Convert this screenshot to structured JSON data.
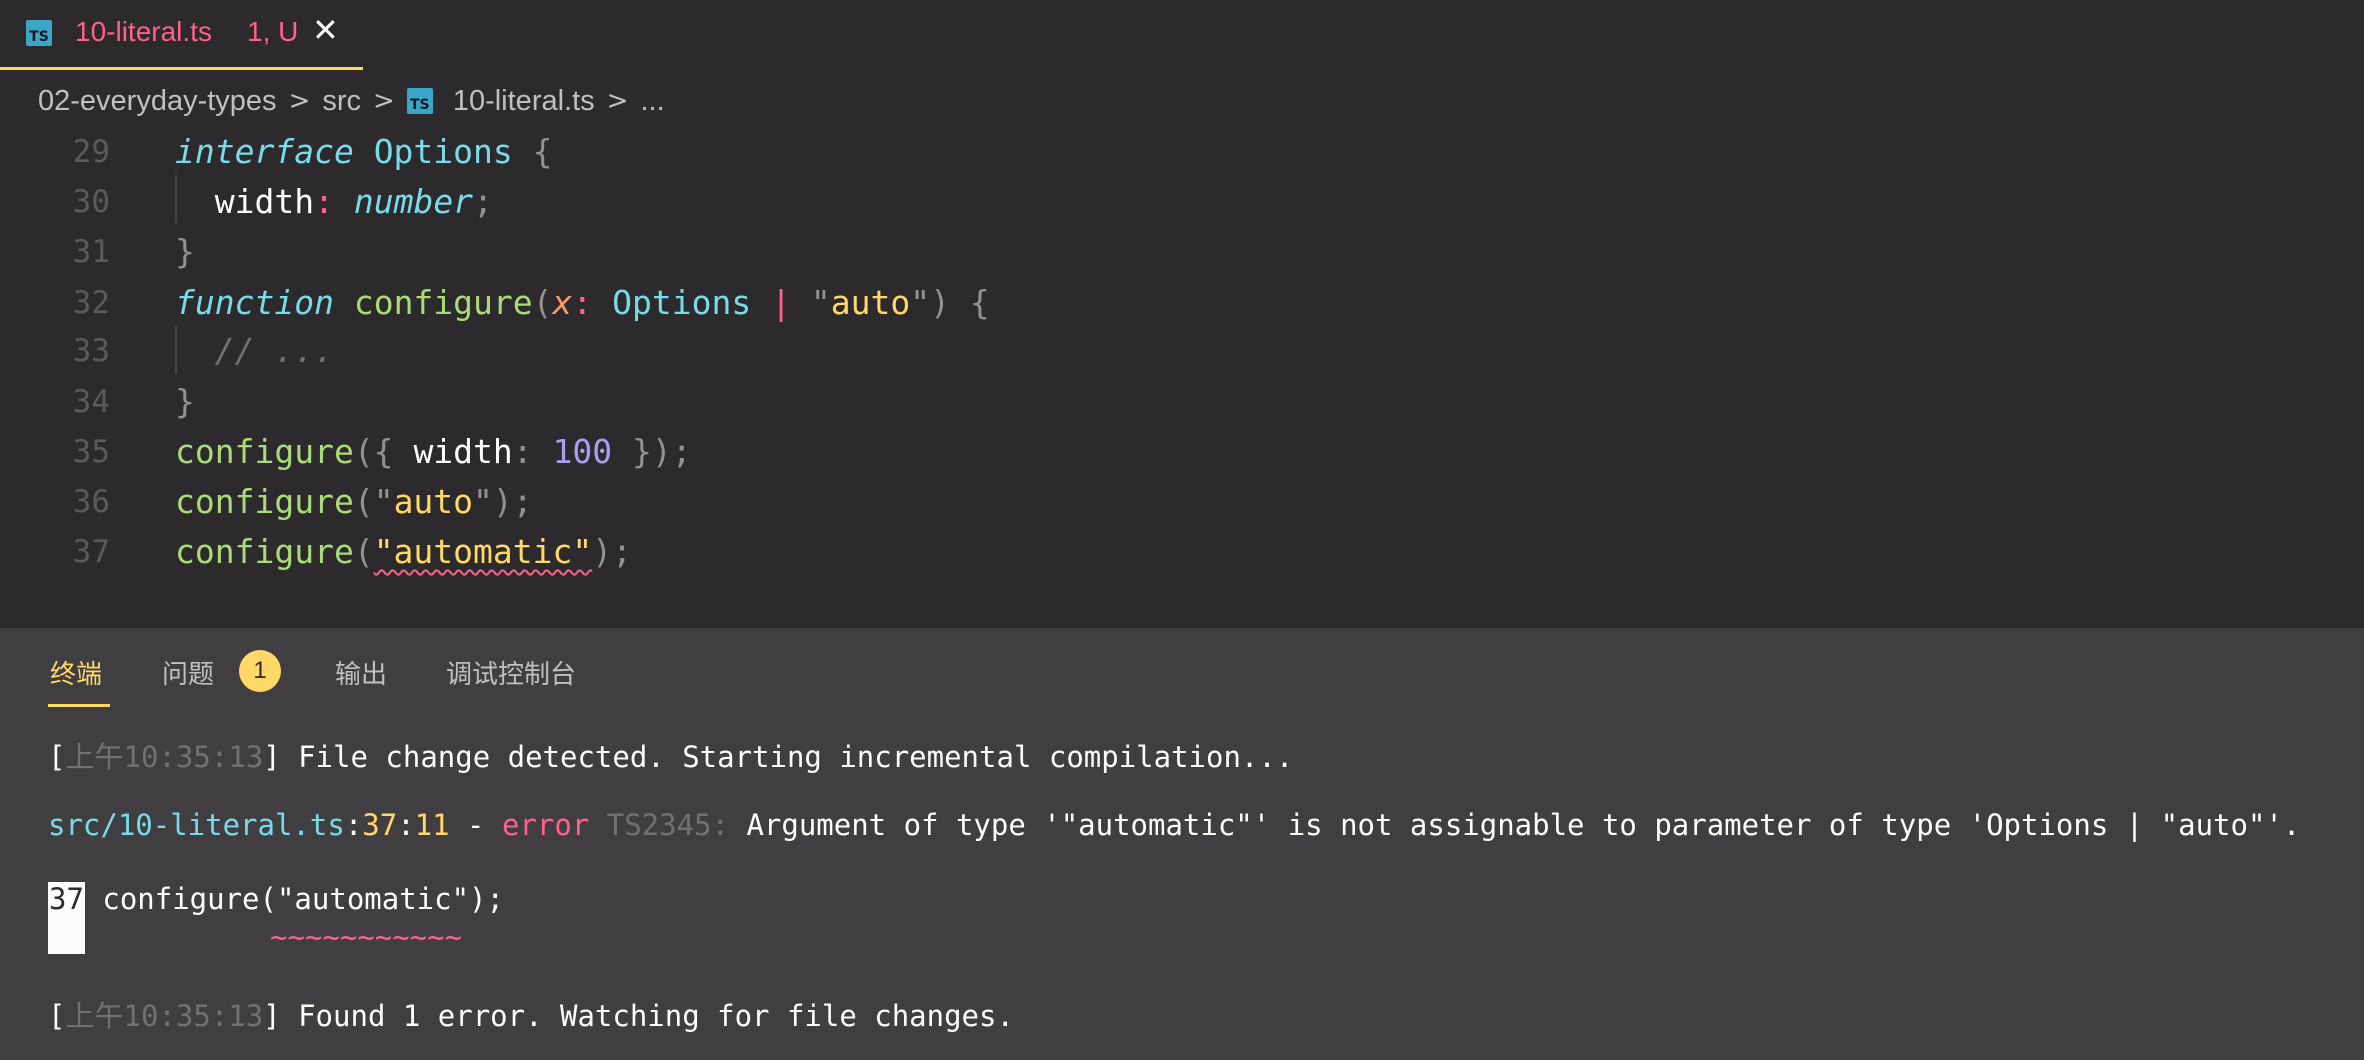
{
  "tab": {
    "icon": "typescript-file-icon",
    "icon_text": "TS",
    "filename": "10-literal.ts",
    "status": "1, U",
    "close_glyph": "✕"
  },
  "breadcrumb": {
    "folder": "02-everyday-types",
    "subfolder": "src",
    "file": "10-literal.ts",
    "more": "...",
    "separator": ">"
  },
  "editor": {
    "line_numbers": [
      "29",
      "30",
      "31",
      "32",
      "33",
      "34",
      "35",
      "36",
      "37"
    ],
    "lines": {
      "l29": {
        "kw": "interface",
        "name": "Options",
        "brace": "{"
      },
      "l30": {
        "prop": "width",
        "colon": ":",
        "type": "number",
        "semi": ";"
      },
      "l31": {
        "brace": "}"
      },
      "l32": {
        "kw": "function",
        "fn": "configure",
        "open": "(",
        "param": "x",
        "colon": ":",
        "type": "Options",
        "pipe": "|",
        "q1": "\"",
        "str": "auto",
        "q2": "\"",
        "close": ")",
        "brace": "{"
      },
      "l33": {
        "comment": "// ..."
      },
      "l34": {
        "brace": "}"
      },
      "l35": {
        "fn": "configure",
        "open": "({",
        "prop": "width",
        "colon": ":",
        "num": "100",
        "close": "});"
      },
      "l36": {
        "fn": "configure",
        "open": "(",
        "q1": "\"",
        "str": "auto",
        "q2": "\"",
        "close": ");"
      },
      "l37": {
        "fn": "configure",
        "open": "(",
        "squig": "\"automatic\"",
        "close": ");"
      }
    }
  },
  "panel": {
    "tabs": {
      "terminal": "终端",
      "problems": "问题",
      "problems_count": "1",
      "output": "输出",
      "debug_console": "调试控制台"
    },
    "terminal": {
      "line1": {
        "open": "[",
        "ampm": "上午",
        "time": "10:35:13",
        "close": "]",
        "text": " File change detected. Starting incremental compilation..."
      },
      "line2": {
        "path": "src/10-literal.ts",
        "c1": ":",
        "line": "37",
        "c2": ":",
        "col": "11",
        "dash": " - ",
        "err": "error",
        "code": " TS2345:",
        "msg": " Argument of type '\"automatic\"' is not assignable to parameter of type 'Options | \"auto\"'."
      },
      "line3": {
        "num": "37",
        "code": " configure(\"automatic\");"
      },
      "tildes": "~~~~~~~~~~~",
      "line4": {
        "open": "[",
        "ampm": "上午",
        "time": "10:35:13",
        "close": "]",
        "text": " Found 1 error. Watching for file changes."
      }
    }
  }
}
